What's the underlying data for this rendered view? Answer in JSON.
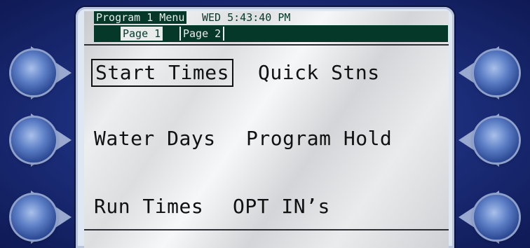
{
  "header": {
    "menu_title": "Program 1 Menu",
    "datetime": "WED 5:43:40 PM"
  },
  "tabs": [
    {
      "label": "Page 1",
      "selected": true
    },
    {
      "label": "Page 2",
      "selected": false
    }
  ],
  "menu": {
    "start_times": "Start Times",
    "quick_stns": "Quick Stns",
    "water_days": "Water Days",
    "program_hold": "Program Hold",
    "run_times": "Run Times",
    "opt_ins": "OPT IN’s"
  },
  "colors": {
    "lcd_dark": "#06382a",
    "panel_blue": "#1b2c78",
    "button_blue": "#5d7fc6"
  }
}
